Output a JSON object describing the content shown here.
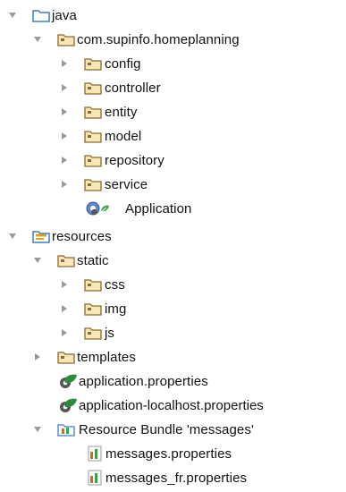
{
  "colors": {
    "folder": "#3f7fbf",
    "resource_folder_accent": "#d9a12a",
    "arrow": "#9a9a9a",
    "properties_green": "#2e8b3b",
    "bundle_orange": "#d46a1a",
    "bundle_green": "#39a04a"
  },
  "tree": {
    "java": {
      "label": "java",
      "icon": "folder-icon"
    },
    "package": {
      "label": "com.supinfo.homeplanning",
      "icon": "package-folder-icon"
    },
    "config": {
      "label": "config",
      "icon": "package-folder-icon"
    },
    "controller": {
      "label": "controller",
      "icon": "package-folder-icon"
    },
    "entity": {
      "label": "entity",
      "icon": "package-folder-icon"
    },
    "model": {
      "label": "model",
      "icon": "package-folder-icon"
    },
    "repository": {
      "label": "repository",
      "icon": "package-folder-icon"
    },
    "service": {
      "label": "service",
      "icon": "package-folder-icon"
    },
    "application": {
      "label": "Application",
      "icon": "spring-boot-class-icon"
    },
    "resources": {
      "label": "resources",
      "icon": "resources-folder-icon"
    },
    "static": {
      "label": "static",
      "icon": "package-folder-icon"
    },
    "css": {
      "label": "css",
      "icon": "package-folder-icon"
    },
    "img": {
      "label": "img",
      "icon": "package-folder-icon"
    },
    "js": {
      "label": "js",
      "icon": "package-folder-icon"
    },
    "templates": {
      "label": "templates",
      "icon": "package-folder-icon"
    },
    "application_properties": {
      "label": "application.properties",
      "icon": "spring-properties-icon"
    },
    "application_localhost_properties": {
      "label": "application-localhost.properties",
      "icon": "spring-properties-icon"
    },
    "resource_bundle": {
      "label": "Resource Bundle 'messages'",
      "icon": "resource-bundle-icon"
    },
    "messages_properties": {
      "label": "messages.properties",
      "icon": "properties-file-icon"
    },
    "messages_fr_properties": {
      "label": "messages_fr.properties",
      "icon": "properties-file-icon"
    }
  }
}
